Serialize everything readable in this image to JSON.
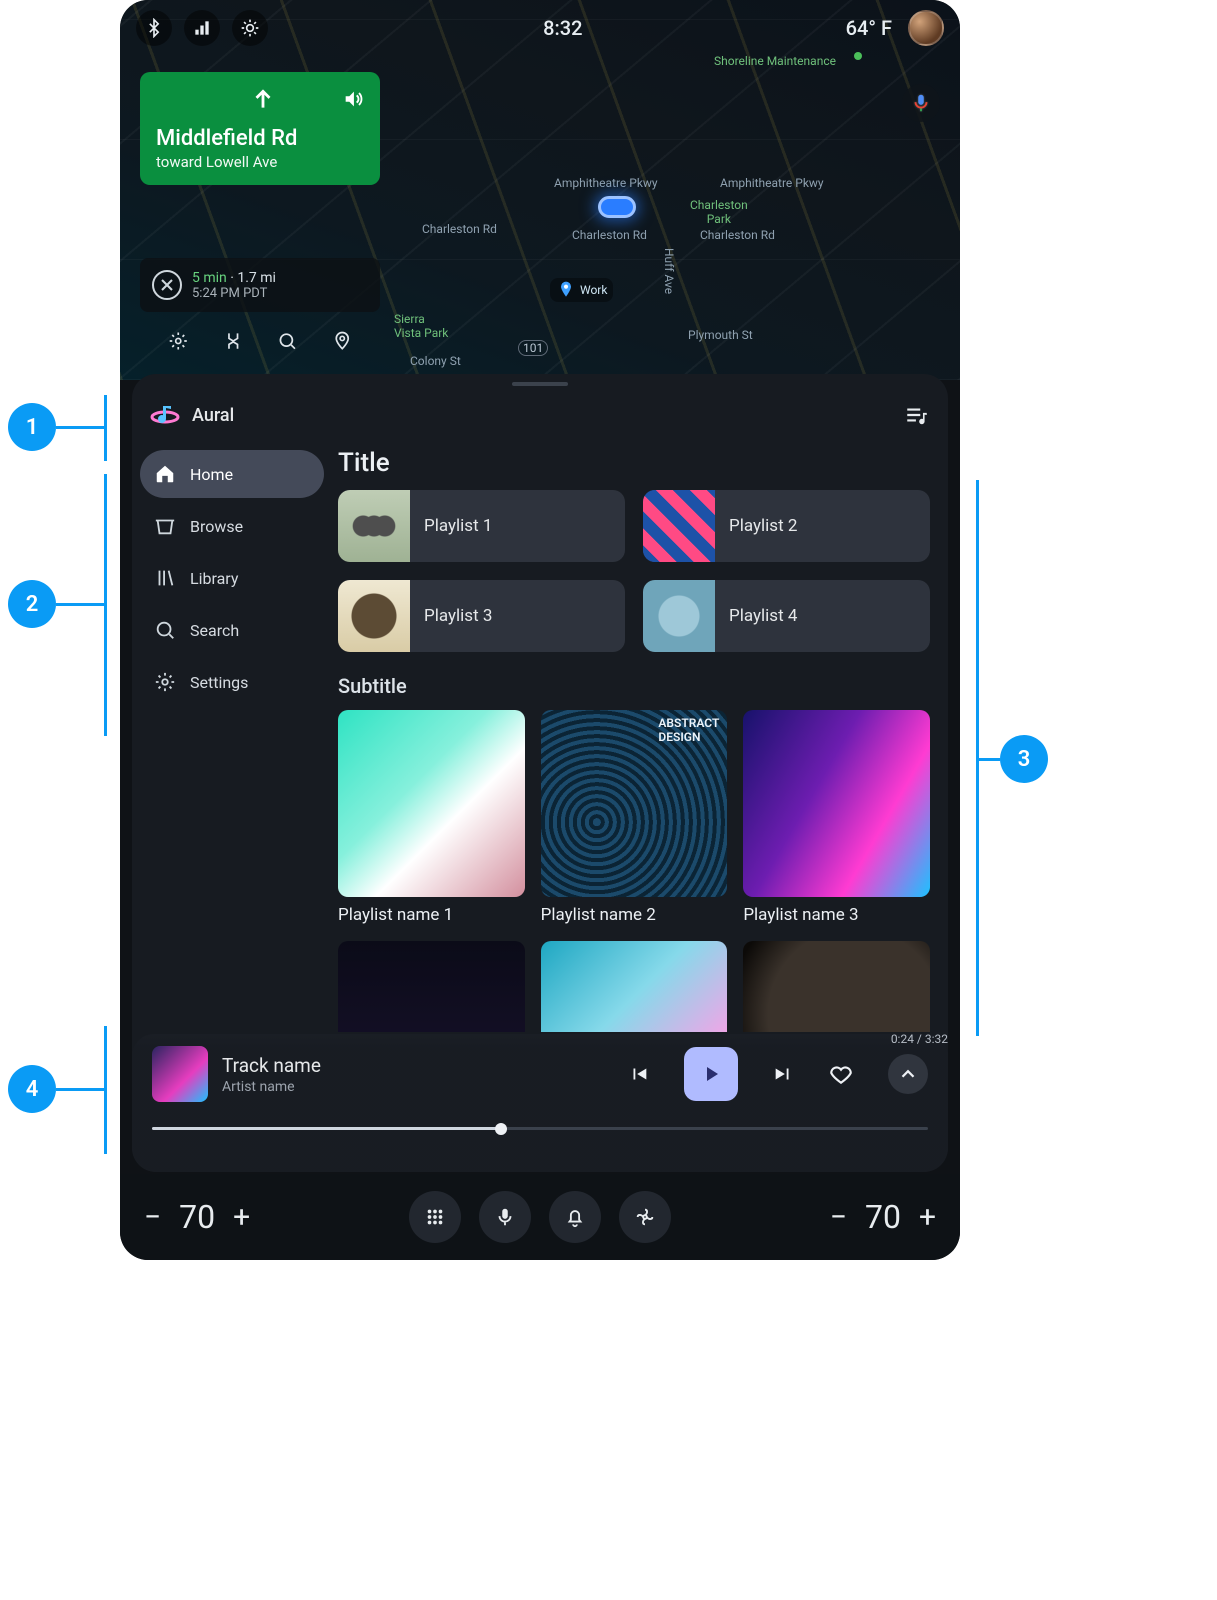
{
  "status": {
    "time": "8:32",
    "temperature": "64° F"
  },
  "nav": {
    "street": "Middlefield Rd",
    "subtitle": "toward Lowell Ave",
    "eta_duration": "5 min",
    "eta_distance": "1.7 mi",
    "eta_time": "5:24 PM PDT"
  },
  "map": {
    "labels": {
      "shoreline": "Shoreline Maintenance",
      "amph1": "Amphitheatre Pkwy",
      "amph2": "Amphitheatre Pkwy",
      "charpark": "Charleston\nPark",
      "charl1": "Charleston Rd",
      "charl2": "Charleston Rd",
      "charl3": "Charleston Rd",
      "huff": "Huff Ave",
      "plymouth": "Plymouth St",
      "sierra": "Sierra\nVista Park",
      "colony": "Colony St",
      "hwy": "101",
      "work": "Work"
    }
  },
  "app": {
    "name": "Aural"
  },
  "sidebar": {
    "items": [
      {
        "label": "Home",
        "icon": "home-icon",
        "active": true
      },
      {
        "label": "Browse",
        "icon": "browse-icon",
        "active": false
      },
      {
        "label": "Library",
        "icon": "library-icon",
        "active": false
      },
      {
        "label": "Search",
        "icon": "search-icon",
        "active": false
      },
      {
        "label": "Settings",
        "icon": "gear-icon",
        "active": false
      }
    ]
  },
  "content": {
    "title": "Title",
    "tiles": [
      {
        "label": "Playlist 1"
      },
      {
        "label": "Playlist 2"
      },
      {
        "label": "Playlist 3"
      },
      {
        "label": "Playlist 4"
      }
    ],
    "subtitle": "Subtitle",
    "cards": [
      {
        "label": "Playlist name 1"
      },
      {
        "label": "Playlist name 2"
      },
      {
        "label": "Playlist name 3"
      }
    ]
  },
  "player": {
    "track": "Track name",
    "artist": "Artist name",
    "elapsed": "0:24",
    "total": "3:32",
    "progress_percent": 45
  },
  "sysbar": {
    "temp_left": "70",
    "temp_right": "70"
  },
  "annotations": {
    "a1": "1",
    "a2": "2",
    "a3": "3",
    "a4": "4"
  }
}
